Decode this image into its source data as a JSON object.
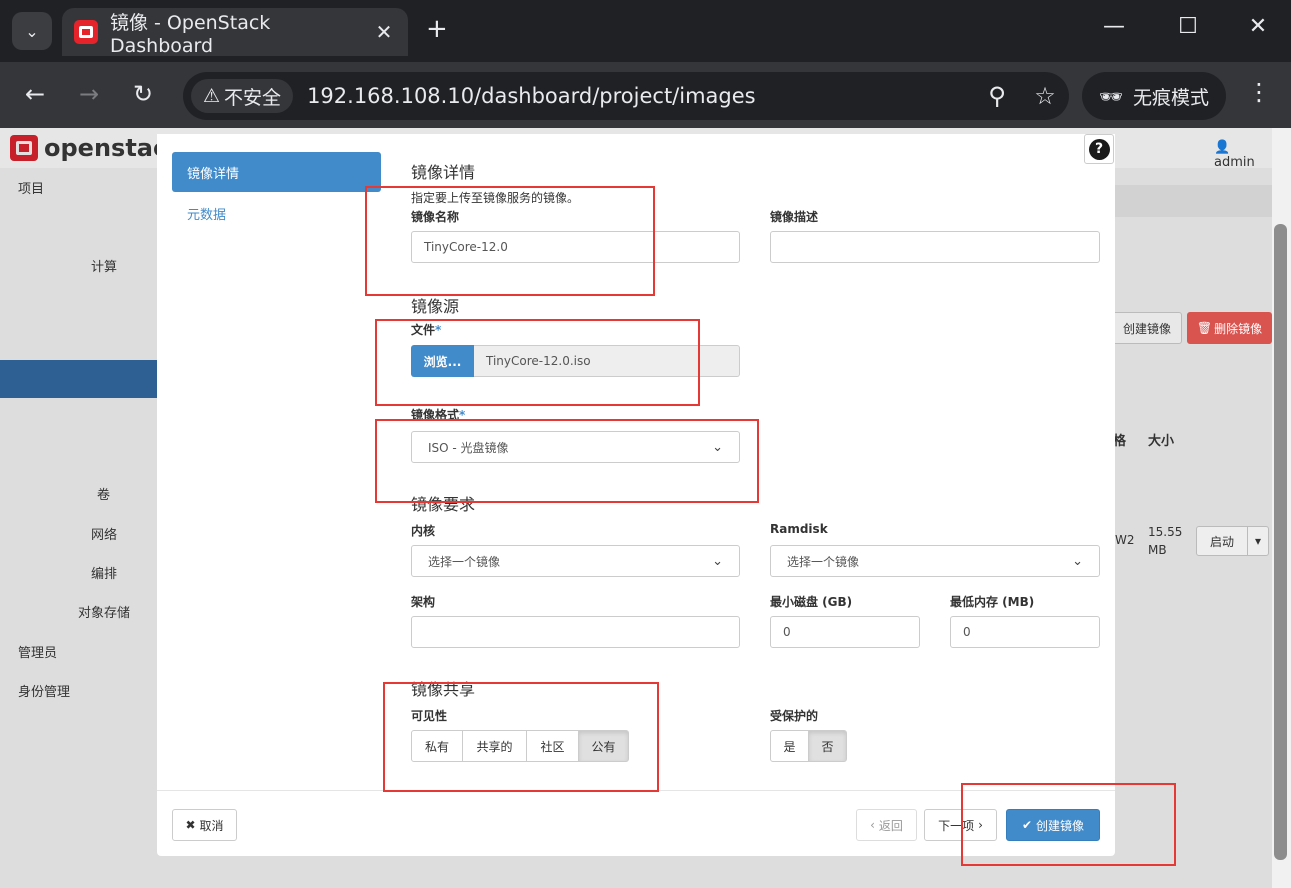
{
  "browser": {
    "tab_title": "镜像 - OpenStack Dashboard",
    "security_label": "不安全",
    "url": "192.168.108.10/dashboard/project/images",
    "incognito_label": "无痕模式"
  },
  "background": {
    "logo_text": "openstack.",
    "user": "admin",
    "nav": {
      "project": "项目",
      "compute": "计算",
      "volumes": "卷",
      "network": "网络",
      "orchestration": "编排",
      "object_store": "对象存储",
      "admin": "管理员",
      "identity": "身份管理"
    },
    "create_image_btn": "创建镜像",
    "delete_images_btn": "删除镜像",
    "col_format_partial": "格",
    "col_size": "大小",
    "row_format_partial": "W2",
    "row_size": "15.55 MB",
    "row_action": "启动"
  },
  "modal": {
    "sidebar": {
      "details": "镜像详情",
      "metadata": "元数据"
    },
    "details_title": "镜像详情",
    "help_text": "指定要上传至镜像服务的镜像。",
    "name_label": "镜像名称",
    "name_value": "TinyCore-12.0",
    "desc_label": "镜像描述",
    "desc_value": "",
    "source_title": "镜像源",
    "file_label": "文件",
    "browse_label": "浏览...",
    "file_name": "TinyCore-12.0.iso",
    "format_label": "镜像格式",
    "format_value": "ISO - 光盘镜像",
    "requirements_title": "镜像要求",
    "kernel_label": "内核",
    "kernel_value": "选择一个镜像",
    "ramdisk_label": "Ramdisk",
    "ramdisk_value": "选择一个镜像",
    "arch_label": "架构",
    "arch_value": "",
    "min_disk_label": "最小磁盘 (GB)",
    "min_disk_value": "0",
    "min_ram_label": "最低内存 (MB)",
    "min_ram_value": "0",
    "sharing_title": "镜像共享",
    "visibility_label": "可见性",
    "visibility_options": [
      "私有",
      "共享的",
      "社区",
      "公有"
    ],
    "visibility_selected": "公有",
    "protected_label": "受保护的",
    "protected_options": [
      "是",
      "否"
    ],
    "protected_selected": "否",
    "footer": {
      "cancel": "取消",
      "back": "返回",
      "next": "下一项",
      "create": "创建镜像"
    }
  },
  "colors": {
    "accent": "#428bca",
    "annotation": "#e53935",
    "danger": "#d9534f"
  }
}
